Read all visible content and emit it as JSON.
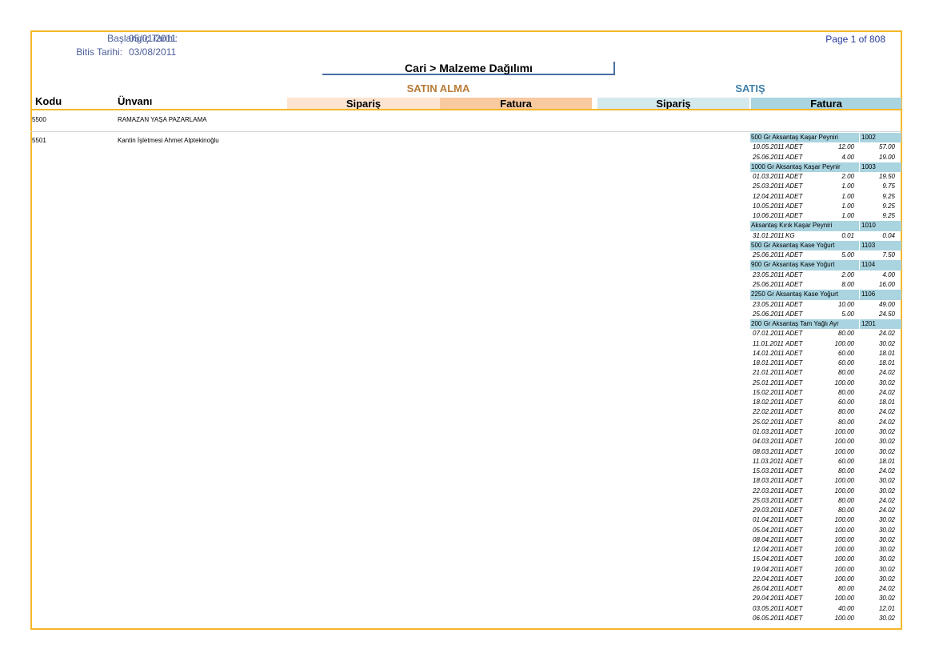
{
  "header": {
    "start_label": "Başlangıç Tarihi:",
    "start_value": "05/01/2011",
    "end_label": "Bitis Tarihi:",
    "end_value": "03/08/2011",
    "page": "Page 1 of 808",
    "title": "Cari > Malzeme Dağılımı"
  },
  "groups": {
    "purchase": "SATIN ALMA",
    "sales": "SATIŞ"
  },
  "columns": {
    "code": "Kodu",
    "name": "Ünvanı",
    "purchase_order": "Sipariş",
    "purchase_invoice": "Fatura",
    "sales_order": "Sipariş",
    "sales_invoice": "Fatura"
  },
  "colors": {
    "border": "#f5b72a",
    "purchase_group": "#b77a36",
    "sales_group": "#3d7fa8",
    "purchase_order_bg": "#fce4d0",
    "purchase_invoice_bg": "#f9c9a0",
    "sales_order_bg": "#d4e9ee",
    "sales_invoice_bg": "#a9d4e0"
  },
  "rows": [
    {
      "code": "5500",
      "name": "RAMAZAN YAŞA PAZARLAMA"
    },
    {
      "code": "5501",
      "name": "Kantin İşletmesi Ahmet Alptekinoğlu"
    }
  ],
  "products": [
    {
      "name": "500 Gr Aksantaş Kaşar Peyniri",
      "code": "1002",
      "lines": [
        {
          "date": "10.05.2011",
          "unit": "ADET",
          "qty": "12.00",
          "amount": "57.00"
        },
        {
          "date": "25.06.2011",
          "unit": "ADET",
          "qty": "4.00",
          "amount": "19.00"
        }
      ]
    },
    {
      "name": "1000 Gr Aksantaş Kaşar Peynir",
      "code": "1003",
      "lines": [
        {
          "date": "01.03.2011",
          "unit": "ADET",
          "qty": "2.00",
          "amount": "19.50"
        },
        {
          "date": "25.03.2011",
          "unit": "ADET",
          "qty": "1.00",
          "amount": "9.75"
        },
        {
          "date": "12.04.2011",
          "unit": "ADET",
          "qty": "1.00",
          "amount": "9.25"
        },
        {
          "date": "10.05.2011",
          "unit": "ADET",
          "qty": "1.00",
          "amount": "9.25"
        },
        {
          "date": "10.06.2011",
          "unit": "ADET",
          "qty": "1.00",
          "amount": "9.25"
        }
      ]
    },
    {
      "name": "Aksantaş Kırık Kaşar Peyniri",
      "code": "1010",
      "lines": [
        {
          "date": "31.01.2011",
          "unit": "KG",
          "qty": "0.01",
          "amount": "0.04"
        }
      ]
    },
    {
      "name": "500 Gr Aksantaş Kase Yoğurt",
      "code": "1103",
      "lines": [
        {
          "date": "25.06.2011",
          "unit": "ADET",
          "qty": "5.00",
          "amount": "7.50"
        }
      ]
    },
    {
      "name": "900 Gr Aksantaş Kase Yoğurt",
      "code": "1104",
      "lines": [
        {
          "date": "23.05.2011",
          "unit": "ADET",
          "qty": "2.00",
          "amount": "4.00"
        },
        {
          "date": "25.06.2011",
          "unit": "ADET",
          "qty": "8.00",
          "amount": "16.00"
        }
      ]
    },
    {
      "name": "2250 Gr Aksantaş Kase Yoğurt",
      "code": "1106",
      "lines": [
        {
          "date": "23.05.2011",
          "unit": "ADET",
          "qty": "10.00",
          "amount": "49.00"
        },
        {
          "date": "25.06.2011",
          "unit": "ADET",
          "qty": "5.00",
          "amount": "24.50"
        }
      ]
    },
    {
      "name": "200 Gr Aksantaş Tam Yağlı Ayr",
      "code": "1201",
      "lines": [
        {
          "date": "07.01.2011",
          "unit": "ADET",
          "qty": "80.00",
          "amount": "24.02"
        },
        {
          "date": "11.01.2011",
          "unit": "ADET",
          "qty": "100.00",
          "amount": "30.02"
        },
        {
          "date": "14.01.2011",
          "unit": "ADET",
          "qty": "60.00",
          "amount": "18.01"
        },
        {
          "date": "18.01.2011",
          "unit": "ADET",
          "qty": "60.00",
          "amount": "18.01"
        },
        {
          "date": "21.01.2011",
          "unit": "ADET",
          "qty": "80.00",
          "amount": "24.02"
        },
        {
          "date": "25.01.2011",
          "unit": "ADET",
          "qty": "100.00",
          "amount": "30.02"
        },
        {
          "date": "15.02.2011",
          "unit": "ADET",
          "qty": "80.00",
          "amount": "24.02"
        },
        {
          "date": "18.02.2011",
          "unit": "ADET",
          "qty": "60.00",
          "amount": "18.01"
        },
        {
          "date": "22.02.2011",
          "unit": "ADET",
          "qty": "80.00",
          "amount": "24.02"
        },
        {
          "date": "25.02.2011",
          "unit": "ADET",
          "qty": "80.00",
          "amount": "24.02"
        },
        {
          "date": "01.03.2011",
          "unit": "ADET",
          "qty": "100.00",
          "amount": "30.02"
        },
        {
          "date": "04.03.2011",
          "unit": "ADET",
          "qty": "100.00",
          "amount": "30.02"
        },
        {
          "date": "08.03.2011",
          "unit": "ADET",
          "qty": "100.00",
          "amount": "30.02"
        },
        {
          "date": "11.03.2011",
          "unit": "ADET",
          "qty": "60.00",
          "amount": "18.01"
        },
        {
          "date": "15.03.2011",
          "unit": "ADET",
          "qty": "80.00",
          "amount": "24.02"
        },
        {
          "date": "18.03.2011",
          "unit": "ADET",
          "qty": "100.00",
          "amount": "30.02"
        },
        {
          "date": "22.03.2011",
          "unit": "ADET",
          "qty": "100.00",
          "amount": "30.02"
        },
        {
          "date": "25.03.2011",
          "unit": "ADET",
          "qty": "80.00",
          "amount": "24.02"
        },
        {
          "date": "29.03.2011",
          "unit": "ADET",
          "qty": "80.00",
          "amount": "24.02"
        },
        {
          "date": "01.04.2011",
          "unit": "ADET",
          "qty": "100.00",
          "amount": "30.02"
        },
        {
          "date": "05.04.2011",
          "unit": "ADET",
          "qty": "100.00",
          "amount": "30.02"
        },
        {
          "date": "08.04.2011",
          "unit": "ADET",
          "qty": "100.00",
          "amount": "30.02"
        },
        {
          "date": "12.04.2011",
          "unit": "ADET",
          "qty": "100.00",
          "amount": "30.02"
        },
        {
          "date": "15.04.2011",
          "unit": "ADET",
          "qty": "100.00",
          "amount": "30.02"
        },
        {
          "date": "19.04.2011",
          "unit": "ADET",
          "qty": "100.00",
          "amount": "30.02"
        },
        {
          "date": "22.04.2011",
          "unit": "ADET",
          "qty": "100.00",
          "amount": "30.02"
        },
        {
          "date": "26.04.2011",
          "unit": "ADET",
          "qty": "80.00",
          "amount": "24.02"
        },
        {
          "date": "29.04.2011",
          "unit": "ADET",
          "qty": "100.00",
          "amount": "30.02"
        },
        {
          "date": "03.05.2011",
          "unit": "ADET",
          "qty": "40.00",
          "amount": "12.01"
        },
        {
          "date": "06.05.2011",
          "unit": "ADET",
          "qty": "100.00",
          "amount": "30.02"
        }
      ]
    }
  ]
}
